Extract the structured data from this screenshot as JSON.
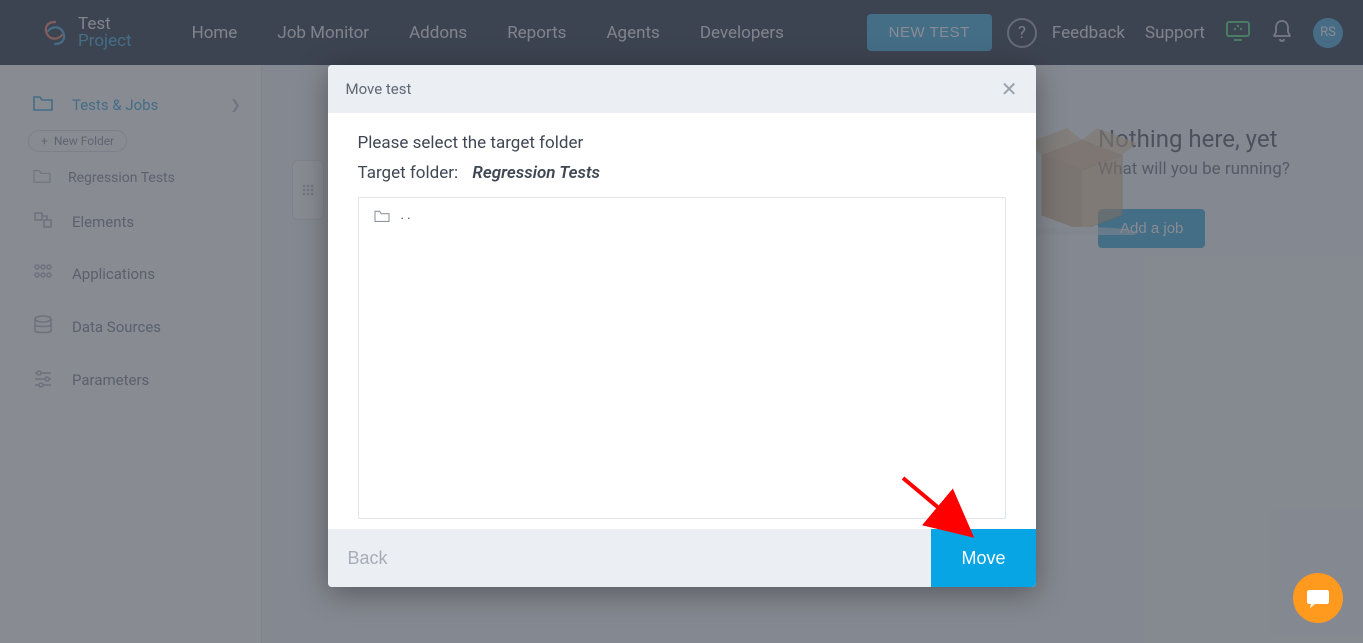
{
  "brand": {
    "line1": "Test",
    "line2": "Project"
  },
  "nav": {
    "home": "Home",
    "job_monitor": "Job Monitor",
    "addons": "Addons",
    "reports": "Reports",
    "agents": "Agents",
    "developers": "Developers"
  },
  "actions": {
    "new_test": "NEW TEST",
    "feedback": "Feedback",
    "support": "Support",
    "avatar": "RS"
  },
  "sidebar": {
    "tests_jobs": "Tests & Jobs",
    "new_folder": "New Folder",
    "regression": "Regression Tests",
    "elements": "Elements",
    "applications": "Applications",
    "data_sources": "Data Sources",
    "parameters": "Parameters"
  },
  "right_panel": {
    "title": "Nothing here, yet",
    "sub": "What will you be running?",
    "add_job": "Add a job"
  },
  "modal": {
    "title": "Move test",
    "instruction": "Please select the target folder",
    "target_label": "Target folder:",
    "target_value": "Regression Tests",
    "parent": ". .",
    "back": "Back",
    "move": "Move"
  }
}
